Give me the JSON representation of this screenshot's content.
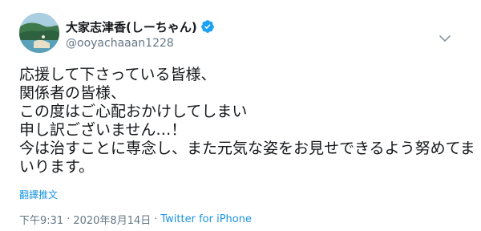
{
  "user": {
    "display_name": "大家志津香(しーちゃん)",
    "handle": "@ooyachaaan1228",
    "verified_icon": "verified-badge-icon",
    "avatar_icon": "profile-avatar"
  },
  "tweet": {
    "lines": [
      "応援して下さっている皆様、",
      "関係者の皆様、",
      "この度はご心配おかけしてしまい",
      "申し訳ございません…！",
      "今は治すことに専念し、また元気な姿をお見せできるよう努めてま",
      "いります。"
    ]
  },
  "translate": {
    "label": "翻譯推文"
  },
  "meta": {
    "time": "下午9:31",
    "separator": "·",
    "date": "2020年8月14日",
    "source": "Twitter for iPhone"
  },
  "colors": {
    "text": "#14171a",
    "secondary": "#657786",
    "link": "#1b95e0",
    "verified": "#1da1f2"
  }
}
